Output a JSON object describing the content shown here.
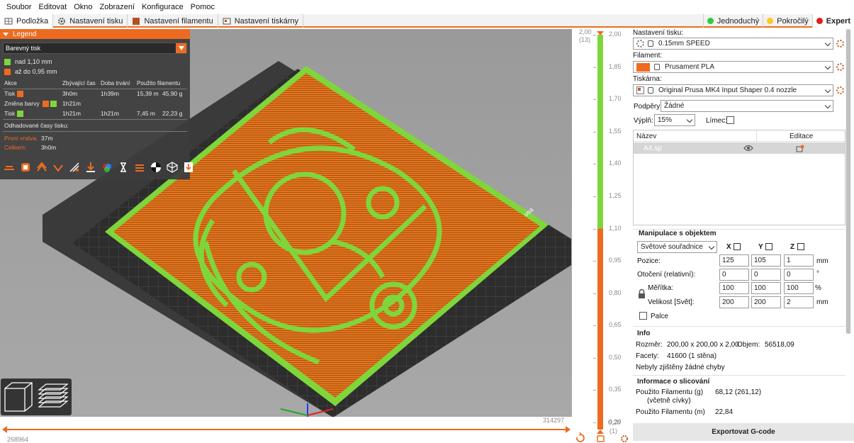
{
  "menu": [
    "Soubor",
    "Editovat",
    "Okno",
    "Zobrazení",
    "Konfigurace",
    "Pomoc"
  ],
  "tabs": [
    {
      "label": "Podložka",
      "icon": "bed-icon"
    },
    {
      "label": "Nastavení tisku",
      "icon": "print-settings-icon"
    },
    {
      "label": "Nastavení filamentu",
      "icon": "filament-spool-icon"
    },
    {
      "label": "Nastavení tiskárny",
      "icon": "printer-icon"
    }
  ],
  "modes": [
    {
      "label": "Jednoduchý",
      "color": "#2ecc40"
    },
    {
      "label": "Pokročilý",
      "color": "#ffc91a"
    },
    {
      "label": "Expert",
      "color": "#e31c1c"
    }
  ],
  "legend": {
    "title": "Legend",
    "view_type": "Barevný tisk",
    "ranges": [
      {
        "label": "nad 1,10 mm",
        "color": "#7fd63b"
      },
      {
        "label": "až do 0,95 mm",
        "color": "#ed6b21"
      }
    ],
    "headers": {
      "action": "Akce",
      "remaining": "Zbývající čas",
      "duration": "Doba trvání",
      "used": "Použito filamentu"
    },
    "rows": [
      {
        "action": "Tisk",
        "remaining": "3h0m",
        "duration": "1h39m",
        "length": "15,39 m",
        "weight": "45,90 g"
      },
      {
        "action": "Změna barvy",
        "remaining": "1h21m",
        "duration": "",
        "length": "",
        "weight": ""
      },
      {
        "action": "Tisk",
        "remaining": "1h21m",
        "duration": "1h21m",
        "length": "7,45 m",
        "weight": "22,23 g"
      }
    ],
    "estimates_title": "Odhadované časy tisku:",
    "first_layer_label": "První vrstva:",
    "first_layer_value": "37m",
    "total_label": "Celkem:",
    "total_value": "3h0m"
  },
  "bed_label": "usa",
  "hslider": {
    "left": "268964",
    "right": "314297"
  },
  "vslider": {
    "top_value": "2,00",
    "top_layer": "(13)",
    "bottom_value": "0,20",
    "bottom_layer": "(1)",
    "ticks": [
      "2,00",
      "1,85",
      "1,70",
      "1,55",
      "1,40",
      "1,25",
      "1,10",
      "0,95",
      "0,80",
      "0,65",
      "0,50",
      "0,35",
      "0,20"
    ],
    "upper_fraction": 0.5,
    "green": "#7fd63b",
    "orange": "#ed6b21"
  },
  "sidebar": {
    "print_label": "Nastavení tisku:",
    "print_value": "0.15mm SPEED",
    "filament_label": "Filament:",
    "filament_value": "Prusament PLA",
    "filament_color": "#ed6b21",
    "printer_label": "Tiskárna:",
    "printer_value": "Original Prusa MK4 Input Shaper 0.4 nozzle",
    "supports_label": "Podpěry:",
    "supports_value": "Žádné",
    "infill_label": "Výplň:",
    "infill_value": "15%",
    "brim_label": "Límec:",
    "list_name_header": "Název",
    "list_edit_header": "Editace",
    "object_name": "A4.sp",
    "manip_title": "Manipulace s objektem",
    "coord_system": "Světové souřadnice",
    "axes": [
      "X",
      "Y",
      "Z"
    ],
    "position_label": "Pozice:",
    "position": [
      "125",
      "105",
      "1"
    ],
    "rotation_label": "Otočení (relativní):",
    "rotation": [
      "0",
      "0",
      "0"
    ],
    "scale_label": "Měřítka:",
    "scale": [
      "100",
      "100",
      "100"
    ],
    "size_label": "Velikost [Svět]:",
    "size": [
      "200",
      "200",
      "2"
    ],
    "unit_mm": "mm",
    "unit_deg": "°",
    "unit_pct": "%",
    "inches_label": "Palce",
    "info_title": "Info",
    "size_info_label": "Rozměr:",
    "size_info_value": "200,00 x 200,00 x 2,00",
    "volume_label": "Objem:",
    "volume_value": "56518,09",
    "facets_label": "Facety:",
    "facets_value": "41600 (1 stěna)",
    "errors_text": "Nebyly zjištěny žádné chyby",
    "slice_title": "Informace o slicování",
    "used_g_label": "Použito Filamentu (g)",
    "used_g_sub": "(včetně cívky)",
    "used_g_value": "68,12 (261,12)",
    "used_m_label": "Použito Filamentu (m)",
    "used_m_value": "22,84",
    "export_label": "Exportovat G-code"
  }
}
